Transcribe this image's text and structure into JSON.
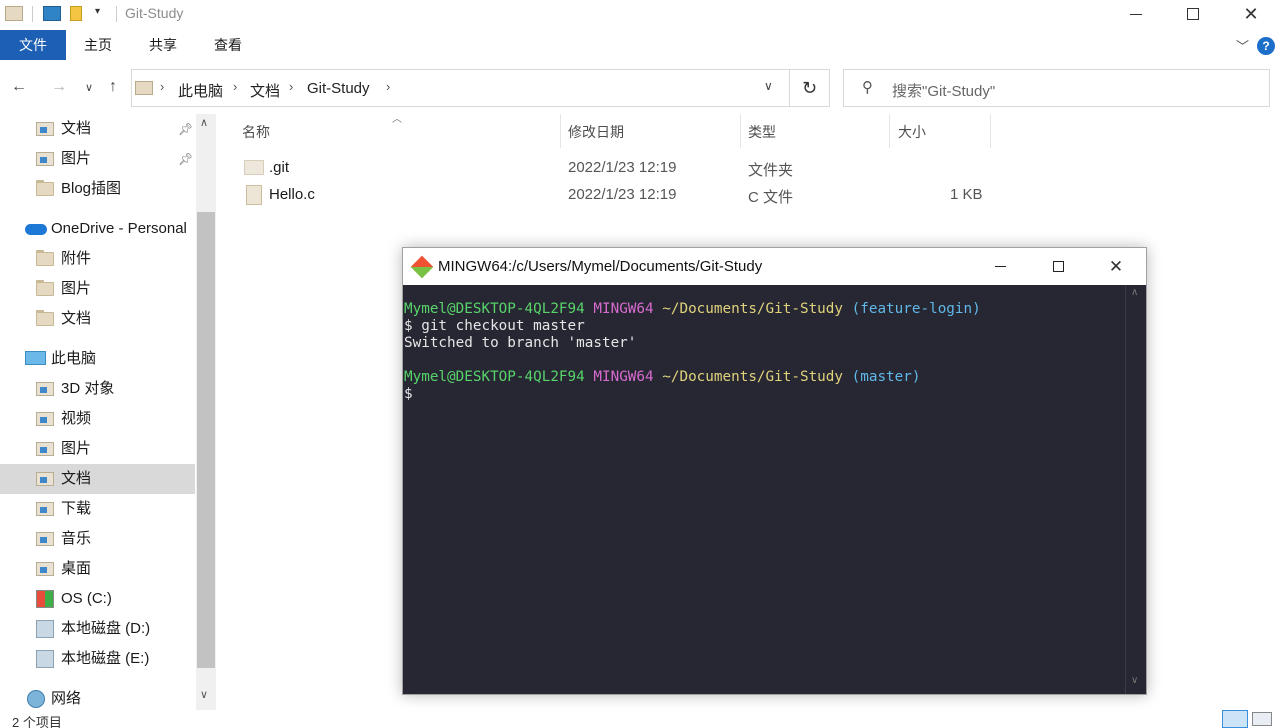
{
  "window": {
    "title": "Git-Study"
  },
  "ribbon": {
    "tabs": [
      "文件",
      "主页",
      "共享",
      "查看"
    ]
  },
  "address": {
    "crumbs": [
      "此电脑",
      "文档",
      "Git-Study"
    ],
    "search_placeholder": "搜索\"Git-Study\""
  },
  "sidebar": {
    "items": [
      {
        "label": "文档",
        "icon": "documents-icon",
        "pinned": true
      },
      {
        "label": "图片",
        "icon": "pictures-icon",
        "pinned": true
      },
      {
        "label": "Blog插图",
        "icon": "folder-icon"
      },
      {
        "label": "OneDrive - Personal",
        "icon": "onedrive-icon"
      },
      {
        "label": "附件",
        "icon": "folder-icon"
      },
      {
        "label": "图片",
        "icon": "folder-icon"
      },
      {
        "label": "文档",
        "icon": "folder-icon"
      },
      {
        "label": "此电脑",
        "icon": "this-pc-icon"
      },
      {
        "label": "3D 对象",
        "icon": "3d-objects-icon"
      },
      {
        "label": "视频",
        "icon": "videos-icon"
      },
      {
        "label": "图片",
        "icon": "pictures-icon"
      },
      {
        "label": "文档",
        "icon": "documents-icon",
        "selected": true
      },
      {
        "label": "下载",
        "icon": "downloads-icon"
      },
      {
        "label": "音乐",
        "icon": "music-icon"
      },
      {
        "label": "桌面",
        "icon": "desktop-icon"
      },
      {
        "label": "OS (C:)",
        "icon": "windows-drive-icon"
      },
      {
        "label": "本地磁盘 (D:)",
        "icon": "drive-icon"
      },
      {
        "label": "本地磁盘 (E:)",
        "icon": "drive-icon"
      },
      {
        "label": "网络",
        "icon": "network-icon"
      }
    ]
  },
  "columns": [
    "名称",
    "修改日期",
    "类型",
    "大小"
  ],
  "files": [
    {
      "name": ".git",
      "modified": "2022/1/23 12:19",
      "type": "文件夹",
      "size": ""
    },
    {
      "name": "Hello.c",
      "modified": "2022/1/23 12:19",
      "type": "C 文件",
      "size": "1 KB"
    }
  ],
  "status": {
    "count": "2 个项目"
  },
  "terminal": {
    "title": "MINGW64:/c/Users/Mymel/Documents/Git-Study",
    "prompt1": {
      "user": "Mymel@DESKTOP-4QL2F94",
      "env": "MINGW64",
      "path": "~/Documents/Git-Study",
      "branch": "(feature-login)"
    },
    "command": "$ git checkout master",
    "output": "Switched to branch 'master'",
    "prompt2": {
      "user": "Mymel@DESKTOP-4QL2F94",
      "env": "MINGW64",
      "path": "~/Documents/Git-Study",
      "branch": "(master)"
    },
    "cursor": "$"
  }
}
